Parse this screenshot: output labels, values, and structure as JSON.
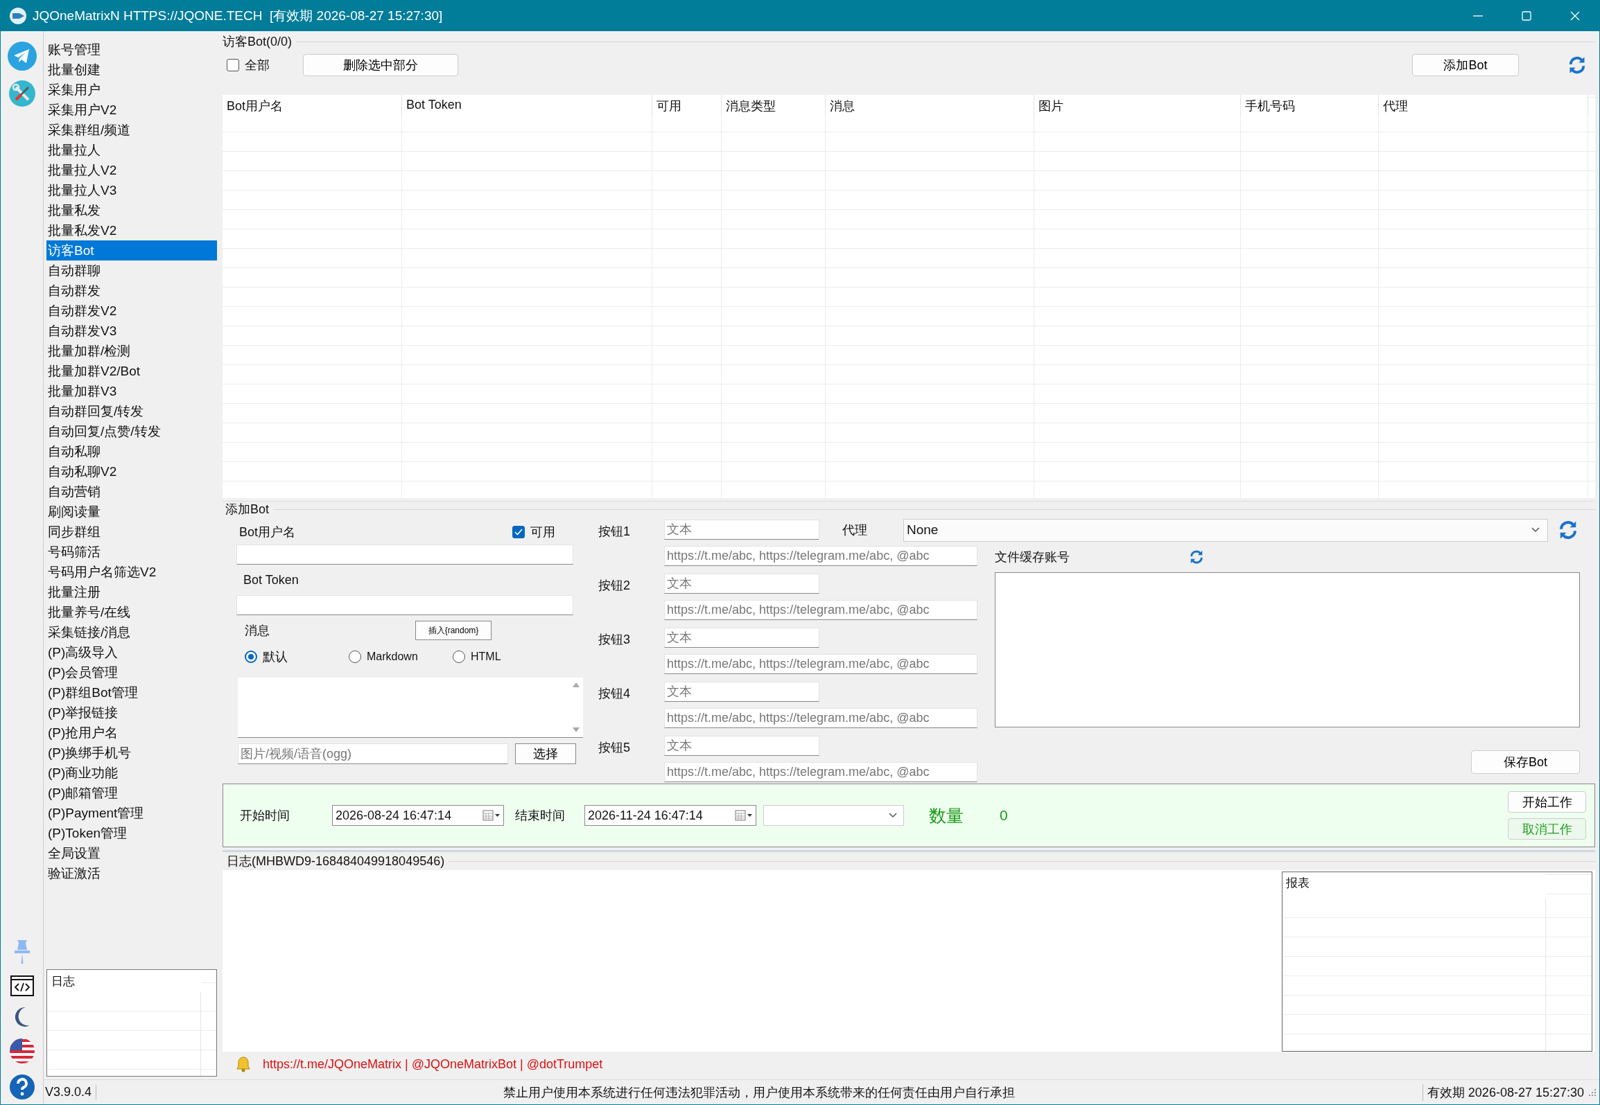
{
  "window": {
    "title": "JQOneMatrixN HTTPS://JQONE.TECH  [有效期 2026-08-27 15:27:30]"
  },
  "sidebar": {
    "items": [
      {
        "label": "账号管理",
        "selected": false
      },
      {
        "label": "批量创建",
        "selected": false
      },
      {
        "label": "采集用户",
        "selected": false
      },
      {
        "label": "采集用户V2",
        "selected": false
      },
      {
        "label": "采集群组/频道",
        "selected": false
      },
      {
        "label": "批量拉人",
        "selected": false
      },
      {
        "label": "批量拉人V2",
        "selected": false
      },
      {
        "label": "批量拉人V3",
        "selected": false
      },
      {
        "label": "批量私发",
        "selected": false
      },
      {
        "label": "批量私发V2",
        "selected": false
      },
      {
        "label": "访客Bot",
        "selected": true
      },
      {
        "label": "自动群聊",
        "selected": false
      },
      {
        "label": "自动群发",
        "selected": false
      },
      {
        "label": "自动群发V2",
        "selected": false
      },
      {
        "label": "自动群发V3",
        "selected": false
      },
      {
        "label": "批量加群/检测",
        "selected": false
      },
      {
        "label": "批量加群V2/Bot",
        "selected": false
      },
      {
        "label": "批量加群V3",
        "selected": false
      },
      {
        "label": "自动群回复/转发",
        "selected": false
      },
      {
        "label": "自动回复/点赞/转发",
        "selected": false
      },
      {
        "label": "自动私聊",
        "selected": false
      },
      {
        "label": "自动私聊V2",
        "selected": false
      },
      {
        "label": "自动营销",
        "selected": false
      },
      {
        "label": "刷阅读量",
        "selected": false
      },
      {
        "label": "同步群组",
        "selected": false
      },
      {
        "label": "号码筛活",
        "selected": false
      },
      {
        "label": "号码用户名筛选V2",
        "selected": false
      },
      {
        "label": "批量注册",
        "selected": false
      },
      {
        "label": "批量养号/在线",
        "selected": false
      },
      {
        "label": "采集链接/消息",
        "selected": false
      },
      {
        "label": "(P)高级导入",
        "selected": false
      },
      {
        "label": "(P)会员管理",
        "selected": false
      },
      {
        "label": "(P)群组Bot管理",
        "selected": false
      },
      {
        "label": "(P)举报链接",
        "selected": false
      },
      {
        "label": "(P)抢用户名",
        "selected": false
      },
      {
        "label": "(P)换绑手机号",
        "selected": false
      },
      {
        "label": "(P)商业功能",
        "selected": false
      },
      {
        "label": "(P)邮箱管理",
        "selected": false
      },
      {
        "label": "(P)Payment管理",
        "selected": false
      },
      {
        "label": "(P)Token管理",
        "selected": false
      },
      {
        "label": "全局设置",
        "selected": false
      },
      {
        "label": "验证激活",
        "selected": false
      }
    ],
    "log_table": {
      "columns": [
        "日志"
      ]
    }
  },
  "bot_list": {
    "title": "访客Bot(0/0)",
    "select_all": {
      "label": "全部",
      "checked": false
    },
    "delete_button": "删除选中部分",
    "add_button": "添加Bot",
    "table": {
      "columns": [
        "Bot用户名",
        "Bot Token",
        "可用",
        "消息类型",
        "消息",
        "图片",
        "手机号码",
        "代理"
      ]
    }
  },
  "add_bot": {
    "title": "添加Bot",
    "username_label": "Bot用户名",
    "enabled": {
      "label": "可用",
      "checked": true
    },
    "token_label": "Bot Token",
    "message_label": "消息",
    "insert_button": "插入{random}",
    "formats": [
      {
        "label": "默认",
        "selected": true
      },
      {
        "label": "Markdown",
        "selected": false
      },
      {
        "label": "HTML",
        "selected": false
      }
    ],
    "media": {
      "placeholder": "图片/视频/语音(ogg)"
    },
    "choose_button": "选择",
    "buttons": [
      {
        "label": "按钮1",
        "text_placeholder": "文本",
        "url_placeholder": "https://t.me/abc, https://telegram.me/abc, @abc"
      },
      {
        "label": "按钮2",
        "text_placeholder": "文本",
        "url_placeholder": "https://t.me/abc, https://telegram.me/abc, @abc"
      },
      {
        "label": "按钮3",
        "text_placeholder": "文本",
        "url_placeholder": "https://t.me/abc, https://telegram.me/abc, @abc"
      },
      {
        "label": "按钮4",
        "text_placeholder": "文本",
        "url_placeholder": "https://t.me/abc, https://telegram.me/abc, @abc"
      },
      {
        "label": "按钮5",
        "text_placeholder": "文本",
        "url_placeholder": "https://t.me/abc, https://telegram.me/abc, @abc"
      }
    ],
    "proxy": {
      "label": "代理",
      "value": "None"
    },
    "cache_label": "文件缓存账号",
    "save_button": "保存Bot"
  },
  "work": {
    "start_label": "开始时间",
    "start": "2026-08-24 16:47:14",
    "end_label": "结束时间",
    "end": "2026-11-24 16:47:14",
    "count_label": "数量",
    "count": "0",
    "start_button": "开始工作",
    "cancel_button": "取消工作"
  },
  "log": {
    "title": "日志(MHBWD9-168484049918049546)",
    "report_columns": [
      "报表"
    ],
    "links": "https://t.me/JQOneMatrix | @JQOneMatrixBot | @dotTrumpet"
  },
  "status_bar": {
    "version": "V3.9.0.4",
    "notice": "禁止用户使用本系统进行任何违法犯罪活动，用户使用本系统带来的任何责任由用户自行承担",
    "expiry": "有效期 2026-08-27 15:27:30"
  }
}
